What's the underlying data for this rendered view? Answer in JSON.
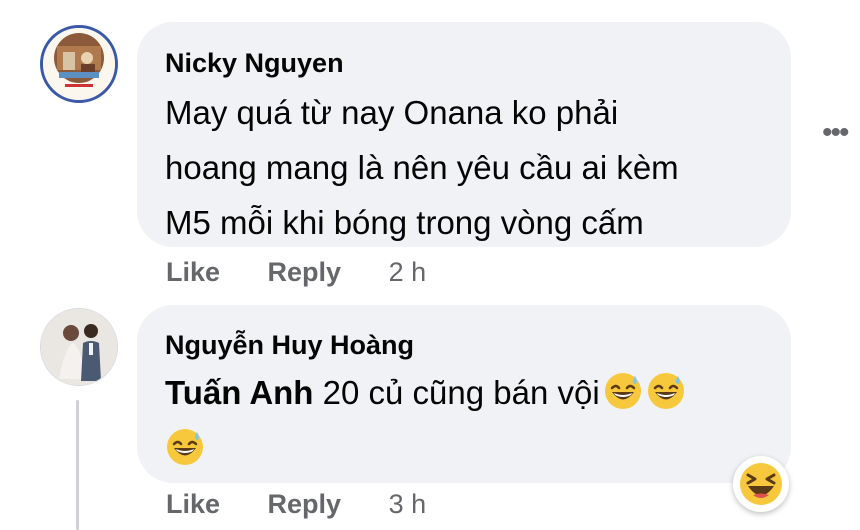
{
  "comments": [
    {
      "author": "Nicky Nguyen",
      "lines": [
        "May quá từ nay Onana ko phải",
        "hoang mang là nên yêu cầu ai kèm",
        "M5 mỗi khi bóng trong vòng cấm"
      ],
      "actions": {
        "like": "Like",
        "reply": "Reply",
        "time": "2 h"
      },
      "avatar_icon": "profile-photo-icon"
    },
    {
      "author": "Nguyễn Huy Hoàng",
      "mention": "Tuấn Anh",
      "text": " 20 củ cũng bán vội",
      "emoji": [
        "grinning-sweat-emoji",
        "grinning-sweat-emoji",
        "grinning-sweat-emoji"
      ],
      "actions": {
        "like": "Like",
        "reply": "Reply",
        "time": "3 h"
      },
      "reaction_icon": "laughing-reaction-icon",
      "avatar_icon": "profile-photo-icon"
    }
  ],
  "more_options_icon": "more-horizontal-icon",
  "more_options_glyph": "•••",
  "colors": {
    "bubble": "#f0f2f5",
    "text": "#050505",
    "meta": "#65676b",
    "avatar_ring": "#3a5aa8",
    "emoji_yellow": "#f7c73c"
  }
}
